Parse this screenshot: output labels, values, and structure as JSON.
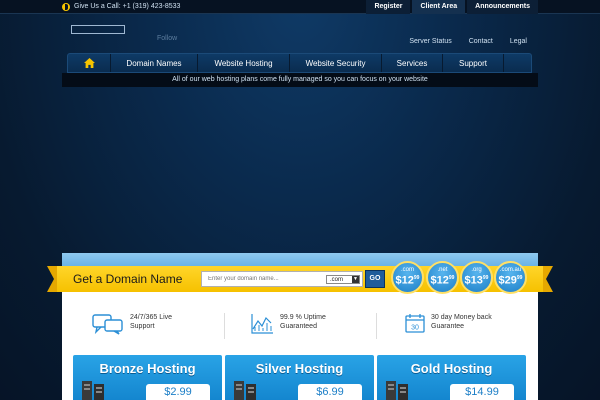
{
  "topbar": {
    "phone_icon": "phone-icon",
    "call_text": "Give Us a Call: +1 (319) 423-8533",
    "links": [
      "Register",
      "Client Area",
      "Announcements"
    ]
  },
  "header": {
    "follow": "Follow",
    "utility_links": [
      "Server Status",
      "Contact",
      "Legal"
    ]
  },
  "nav": {
    "home_icon": "home-icon",
    "items": [
      "Domain Names",
      "Website Hosting",
      "Website Security",
      "Services",
      "Support"
    ]
  },
  "tagline": "All of our web hosting plans come fully managed so you can focus on your website",
  "domain_search": {
    "title": "Get a Domain Name",
    "placeholder": "Enter your domain name...",
    "tld_selected": ".com",
    "go_label": "GO",
    "bubbles": [
      {
        "ext": ".com",
        "price": "$12",
        "cents": "99"
      },
      {
        "ext": ".net",
        "price": "$12",
        "cents": "99"
      },
      {
        "ext": ".org",
        "price": "$13",
        "cents": "99"
      },
      {
        "ext": ".com.au",
        "price": "$29",
        "cents": "99"
      }
    ]
  },
  "features": [
    {
      "icon": "chat-support-icon",
      "line1": "24/7/365 Live",
      "line2": "Support"
    },
    {
      "icon": "uptime-chart-icon",
      "line1": "99.9 % Uptime",
      "line2": "Guaranteed"
    },
    {
      "icon": "calendar-icon",
      "line1": "30 day Money back",
      "line2": "Guarantee"
    }
  ],
  "plans": [
    {
      "name": "Bronze Hosting",
      "price": "$2.99"
    },
    {
      "name": "Silver Hosting",
      "price": "$6.99"
    },
    {
      "name": "Gold Hosting",
      "price": "$14.99"
    }
  ],
  "colors": {
    "accent_yellow": "#f6c100",
    "brand_blue": "#1d7fc7",
    "background_navy": "#0a2a4d"
  }
}
